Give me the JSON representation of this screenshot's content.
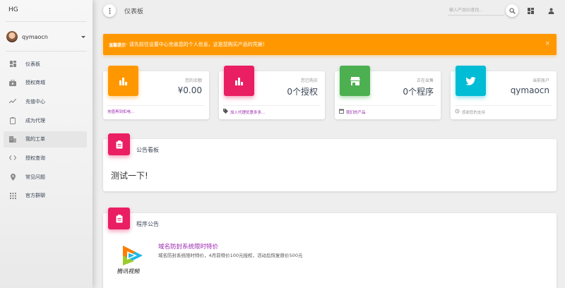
{
  "sidebar": {
    "brand": "HG",
    "username": "qymaocn",
    "items": [
      {
        "label": "仪表板",
        "icon": "dashboard-icon"
      },
      {
        "label": "授权商城",
        "icon": "shopping-bag-icon"
      },
      {
        "label": "充值中心",
        "icon": "trending-icon"
      },
      {
        "label": "成为代理",
        "icon": "clipboard-icon"
      },
      {
        "label": "我的工单",
        "icon": "building-icon"
      },
      {
        "label": "授权查询",
        "icon": "code-icon"
      },
      {
        "label": "常见问题",
        "icon": "location-pin-icon"
      },
      {
        "label": "官方群聊",
        "icon": "apps-grid-icon"
      }
    ],
    "active_index": 4
  },
  "header": {
    "title": "仪表板",
    "search_placeholder": "输入产品ID查找..."
  },
  "alert": {
    "prefix": "温馨提示",
    "message": " - 请先前往设置中心完善您的个人信息，这是您购买产品的凭据！",
    "close": "×"
  },
  "stats": [
    {
      "label": "您的余额",
      "value": "¥0.00",
      "footer": "充值再到扣电...",
      "color": "#ff9800",
      "icon": "bar-chart-icon"
    },
    {
      "label": "您已购买",
      "value": "0个授权",
      "footer": "加入代理优惠多多...",
      "color": "#e91e63",
      "icon": "bar-chart-icon"
    },
    {
      "label": "正在出售",
      "value": "0个程序",
      "footer": "我们的产品",
      "color": "#4caf50",
      "icon": "store-icon"
    },
    {
      "label": "当前账户",
      "value": "qymaocn",
      "footer": "感谢您的支持",
      "color": "#00bcd4",
      "icon": "twitter-bird-icon"
    }
  ],
  "notice_board": {
    "title": "公告看板",
    "content": "测试一下!"
  },
  "program_notice": {
    "title": "程序公告",
    "item_title": "域名防封系统限时特价",
    "item_desc": "域名防封系统限时特价，4月前特价100元授权，活动后恢复原价500元",
    "logo_text": "腾讯视频"
  }
}
